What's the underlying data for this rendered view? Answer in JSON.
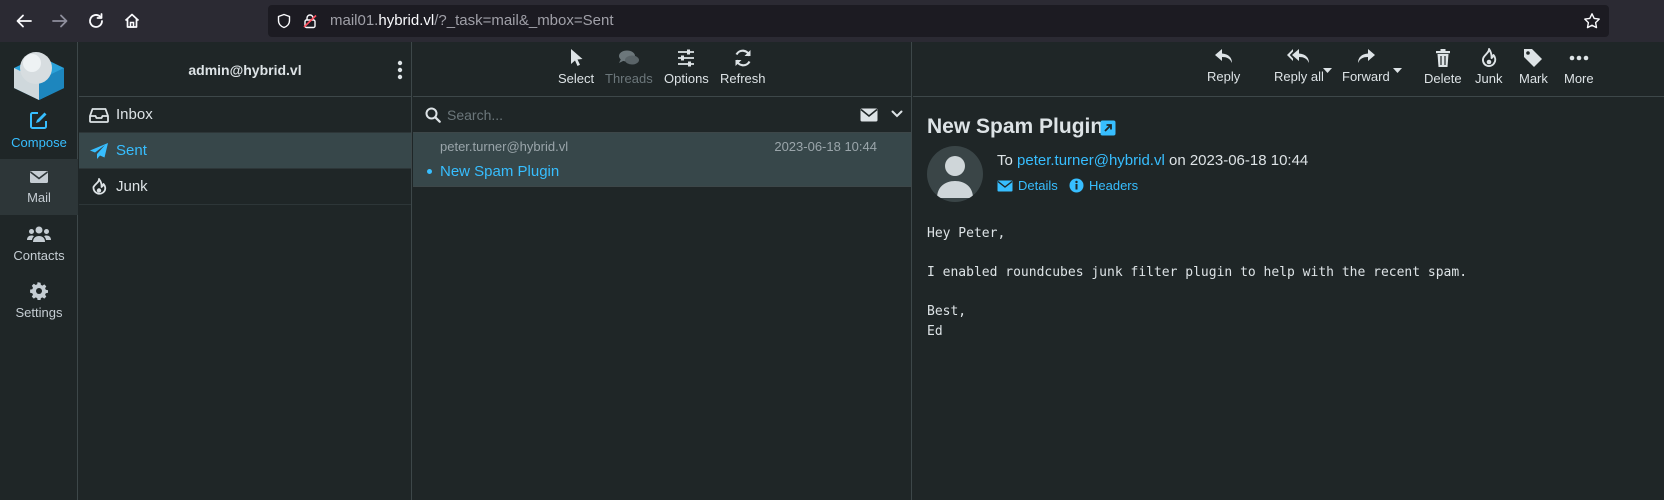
{
  "browser": {
    "url_host_prefix": "mail01.",
    "url_host": "hybrid.vl",
    "url_path": "/?_task=mail&_mbox=Sent"
  },
  "nav": {
    "compose": "Compose",
    "mail": "Mail",
    "contacts": "Contacts",
    "settings": "Settings"
  },
  "folders": {
    "account": "admin@hybrid.vl",
    "items": [
      {
        "label": "Inbox"
      },
      {
        "label": "Sent"
      },
      {
        "label": "Junk"
      }
    ]
  },
  "list_toolbar": {
    "select": "Select",
    "threads": "Threads",
    "options": "Options",
    "refresh": "Refresh"
  },
  "search": {
    "placeholder": "Search..."
  },
  "messages": [
    {
      "from": "peter.turner@hybrid.vl",
      "date": "2023-06-18 10:44",
      "subject": "New Spam Plugin"
    }
  ],
  "preview_toolbar": {
    "reply": "Reply",
    "reply_all": "Reply all",
    "forward": "Forward",
    "delete": "Delete",
    "junk": "Junk",
    "mark": "Mark",
    "more": "More"
  },
  "preview": {
    "subject": "New Spam Plugin",
    "to_label": "To",
    "to_address": "peter.turner@hybrid.vl",
    "on_label": "on",
    "date": "2023-06-18 10:44",
    "details": "Details",
    "headers": "Headers",
    "body": "Hey Peter,\n\nI enabled roundcubes junk filter plugin to help with the recent spam.\n\nBest,\nEd"
  },
  "colors": {
    "accent": "#37beff",
    "background": "#1f2627",
    "selected_row": "#37474a"
  }
}
